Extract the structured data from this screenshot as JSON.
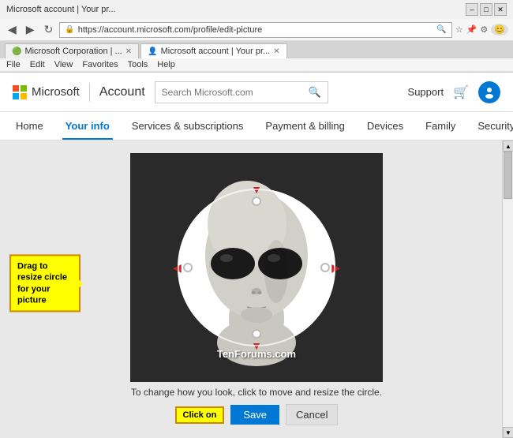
{
  "window": {
    "title": "Microsoft account | Your pr...",
    "url": "https://account.microsoft.com/profile/edit-picture",
    "url_display": "https://account.microsoft.com/profile/edit-picture"
  },
  "titlebar": {
    "minimize": "–",
    "maximize": "□",
    "close": "✕"
  },
  "browser_tabs": [
    {
      "label": "Microsoft Corporation | ...",
      "active": false
    },
    {
      "label": "Microsoft account | Your pr...",
      "active": true
    }
  ],
  "menubar": {
    "items": [
      "File",
      "Edit",
      "View",
      "Favorites",
      "Tools",
      "Help"
    ]
  },
  "header": {
    "logo_text": "Microsoft",
    "account_label": "Account",
    "search_placeholder": "Search Microsoft.com",
    "support_label": "Support"
  },
  "nav": {
    "items": [
      "Home",
      "Your info",
      "Services & subscriptions",
      "Payment & billing",
      "Devices",
      "Family",
      "Security & privacy"
    ],
    "active": "Your info"
  },
  "editor": {
    "caption": "To change how you look, click to move and resize the circle.",
    "tooltip": "Drag to resize circle for your picture",
    "click_on_label": "Click on",
    "watermark": "TenForums.com",
    "save_label": "Save",
    "cancel_label": "Cancel"
  }
}
